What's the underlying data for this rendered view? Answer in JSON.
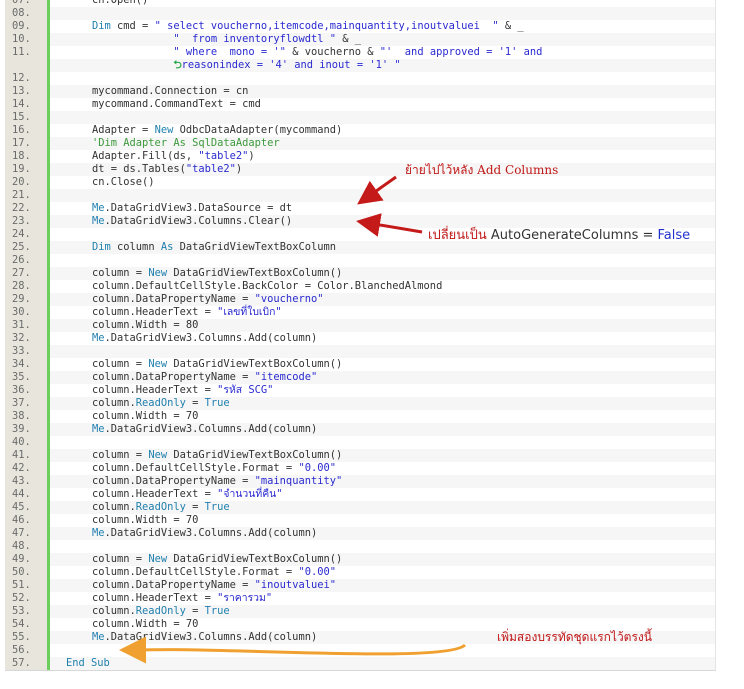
{
  "code_lines": [
    {
      "n": "07.",
      "t": [
        [
          "p",
          "cn.Open()"
        ]
      ]
    },
    {
      "n": "08.",
      "t": []
    },
    {
      "n": "09.",
      "t": [
        [
          "k",
          "Dim"
        ],
        [
          "p",
          " cmd = "
        ],
        [
          "s",
          "\" select voucherno,itemcode,mainquantity,inoutvaluei  \""
        ],
        [
          "p",
          " & _"
        ]
      ]
    },
    {
      "n": "10.",
      "t": [
        [
          "p",
          "             "
        ],
        [
          "s",
          "\"  from inventoryflowdtl \""
        ],
        [
          "p",
          " & _"
        ]
      ]
    },
    {
      "n": "11.",
      "t": [
        [
          "p",
          "             "
        ],
        [
          "s",
          "\" where  mono = '\""
        ],
        [
          "p",
          " & voucherno & "
        ],
        [
          "s",
          "\"'  and approved = '1' and"
        ]
      ]
    },
    {
      "n": "",
      "wrap": true,
      "t": [
        [
          "p",
          "             "
        ],
        [
          "w",
          "⮌"
        ],
        [
          "s",
          "reasonindex = '4' and inout = '1' \""
        ]
      ]
    },
    {
      "n": "12.",
      "t": []
    },
    {
      "n": "13.",
      "t": [
        [
          "p",
          "mycommand.Connection = cn"
        ]
      ]
    },
    {
      "n": "14.",
      "t": [
        [
          "p",
          "mycommand.CommandText = cmd"
        ]
      ]
    },
    {
      "n": "15.",
      "t": []
    },
    {
      "n": "16.",
      "t": [
        [
          "p",
          "Adapter = "
        ],
        [
          "k",
          "New"
        ],
        [
          "p",
          " OdbcDataAdapter(mycommand)"
        ]
      ]
    },
    {
      "n": "17.",
      "t": [
        [
          "c",
          "'Dim Adapter As SqlDataAdapter"
        ]
      ]
    },
    {
      "n": "18.",
      "t": [
        [
          "p",
          "Adapter.Fill(ds, "
        ],
        [
          "s",
          "\"table2\""
        ],
        [
          "p",
          ")"
        ]
      ]
    },
    {
      "n": "19.",
      "t": [
        [
          "p",
          "dt = ds.Tables("
        ],
        [
          "s",
          "\"table2\""
        ],
        [
          "p",
          ")"
        ]
      ]
    },
    {
      "n": "20.",
      "t": [
        [
          "p",
          "cn.Close()"
        ]
      ]
    },
    {
      "n": "21.",
      "t": []
    },
    {
      "n": "22.",
      "t": [
        [
          "k",
          "Me"
        ],
        [
          "p",
          ".DataGridView3.DataSource = dt"
        ]
      ]
    },
    {
      "n": "23.",
      "t": [
        [
          "k",
          "Me"
        ],
        [
          "p",
          ".DataGridView3.Columns.Clear()"
        ]
      ]
    },
    {
      "n": "24.",
      "t": []
    },
    {
      "n": "25.",
      "t": [
        [
          "k",
          "Dim"
        ],
        [
          "p",
          " column "
        ],
        [
          "k",
          "As"
        ],
        [
          "p",
          " DataGridViewTextBoxColumn"
        ]
      ]
    },
    {
      "n": "26.",
      "t": []
    },
    {
      "n": "27.",
      "t": [
        [
          "p",
          "column = "
        ],
        [
          "k",
          "New"
        ],
        [
          "p",
          " DataGridViewTextBoxColumn()"
        ]
      ]
    },
    {
      "n": "28.",
      "t": [
        [
          "p",
          "column.DefaultCellStyle.BackColor = Color.BlanchedAlmond"
        ]
      ]
    },
    {
      "n": "29.",
      "t": [
        [
          "p",
          "column.DataPropertyName = "
        ],
        [
          "s",
          "\"voucherno\""
        ]
      ]
    },
    {
      "n": "30.",
      "t": [
        [
          "p",
          "column.HeaderText = "
        ],
        [
          "s",
          "\"เลขที่ใบเบิก\""
        ]
      ]
    },
    {
      "n": "31.",
      "t": [
        [
          "p",
          "column.Width = 80"
        ]
      ]
    },
    {
      "n": "32.",
      "t": [
        [
          "k",
          "Me"
        ],
        [
          "p",
          ".DataGridView3.Columns.Add(column)"
        ]
      ]
    },
    {
      "n": "33.",
      "t": []
    },
    {
      "n": "34.",
      "t": [
        [
          "p",
          "column = "
        ],
        [
          "k",
          "New"
        ],
        [
          "p",
          " DataGridViewTextBoxColumn()"
        ]
      ]
    },
    {
      "n": "35.",
      "t": [
        [
          "p",
          "column.DataPropertyName = "
        ],
        [
          "s",
          "\"itemcode\""
        ]
      ]
    },
    {
      "n": "36.",
      "t": [
        [
          "p",
          "column.HeaderText = "
        ],
        [
          "s",
          "\"รหัส SCG\""
        ]
      ]
    },
    {
      "n": "37.",
      "t": [
        [
          "p",
          "column."
        ],
        [
          "k",
          "ReadOnly"
        ],
        [
          "p",
          " = "
        ],
        [
          "k",
          "True"
        ]
      ]
    },
    {
      "n": "38.",
      "t": [
        [
          "p",
          "column.Width = 70"
        ]
      ]
    },
    {
      "n": "39.",
      "t": [
        [
          "k",
          "Me"
        ],
        [
          "p",
          ".DataGridView3.Columns.Add(column)"
        ]
      ]
    },
    {
      "n": "40.",
      "t": []
    },
    {
      "n": "41.",
      "t": [
        [
          "p",
          "column = "
        ],
        [
          "k",
          "New"
        ],
        [
          "p",
          " DataGridViewTextBoxColumn()"
        ]
      ]
    },
    {
      "n": "42.",
      "t": [
        [
          "p",
          "column.DefaultCellStyle.Format = "
        ],
        [
          "s",
          "\"0.00\""
        ]
      ]
    },
    {
      "n": "43.",
      "t": [
        [
          "p",
          "column.DataPropertyName = "
        ],
        [
          "s",
          "\"mainquantity\""
        ]
      ]
    },
    {
      "n": "44.",
      "t": [
        [
          "p",
          "column.HeaderText = "
        ],
        [
          "s",
          "\"จำนวนที่คืน\""
        ]
      ]
    },
    {
      "n": "45.",
      "t": [
        [
          "p",
          "column."
        ],
        [
          "k",
          "ReadOnly"
        ],
        [
          "p",
          " = "
        ],
        [
          "k",
          "True"
        ]
      ]
    },
    {
      "n": "46.",
      "t": [
        [
          "p",
          "column.Width = 70"
        ]
      ]
    },
    {
      "n": "47.",
      "t": [
        [
          "k",
          "Me"
        ],
        [
          "p",
          ".DataGridView3.Columns.Add(column)"
        ]
      ]
    },
    {
      "n": "48.",
      "t": []
    },
    {
      "n": "49.",
      "t": [
        [
          "p",
          "column = "
        ],
        [
          "k",
          "New"
        ],
        [
          "p",
          " DataGridViewTextBoxColumn()"
        ]
      ]
    },
    {
      "n": "50.",
      "t": [
        [
          "p",
          "column.DefaultCellStyle.Format = "
        ],
        [
          "s",
          "\"0.00\""
        ]
      ]
    },
    {
      "n": "51.",
      "t": [
        [
          "p",
          "column.DataPropertyName = "
        ],
        [
          "s",
          "\"inoutvaluei\""
        ]
      ]
    },
    {
      "n": "52.",
      "t": [
        [
          "p",
          "column.HeaderText = "
        ],
        [
          "s",
          "\"ราคารวม\""
        ]
      ]
    },
    {
      "n": "53.",
      "t": [
        [
          "p",
          "column."
        ],
        [
          "k",
          "ReadOnly"
        ],
        [
          "p",
          " = "
        ],
        [
          "k",
          "True"
        ]
      ]
    },
    {
      "n": "54.",
      "t": [
        [
          "p",
          "column.Width = 70"
        ]
      ]
    },
    {
      "n": "55.",
      "t": [
        [
          "k",
          "Me"
        ],
        [
          "p",
          ".DataGridView3.Columns.Add(column)"
        ]
      ]
    },
    {
      "n": "56.",
      "t": []
    },
    {
      "n": "57.",
      "outdent": true,
      "t": [
        [
          "k",
          "End Sub"
        ]
      ]
    }
  ],
  "annotations": {
    "move_note": "ย้ายไปไว้หลัง Add Columns",
    "change_note_thai": "เปลี่ยนเป็น",
    "change_note_prop": "AutoGenerateColumns =",
    "change_note_value": "False",
    "add_note": "เพิ่มสองบรรทัดชุดแรกไว้ตรงนี้"
  },
  "colors": {
    "keyword": "#1f7fae",
    "string": "#2a2ad0",
    "comment": "#3c9a3c",
    "annotation": "#c01818",
    "arrow_red": "#c41a1a",
    "arrow_orange": "#f0a030",
    "gutter_border": "#6ccf5c"
  }
}
